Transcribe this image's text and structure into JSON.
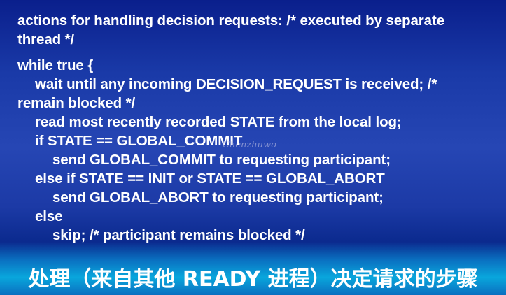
{
  "slide": {
    "lines": [
      "actions for handling decision requests: /* executed by separate",
      "thread */",
      "while true {",
      "wait until any incoming DECISION_REQUEST is received; /*",
      "remain blocked */",
      "read most recently recorded STATE from the local log;",
      "if STATE == GLOBAL_COMMIT",
      "send GLOBAL_COMMIT to requesting participant;",
      "else if STATE == INIT or STATE == GLOBAL_ABORT",
      "send GLOBAL_ABORT to requesting participant;",
      "else",
      "skip;  /* participant remains blocked */"
    ],
    "watermark": "Chenzhuwo",
    "footer": "处理（来自其他 READY 进程）决定请求的步骤"
  }
}
